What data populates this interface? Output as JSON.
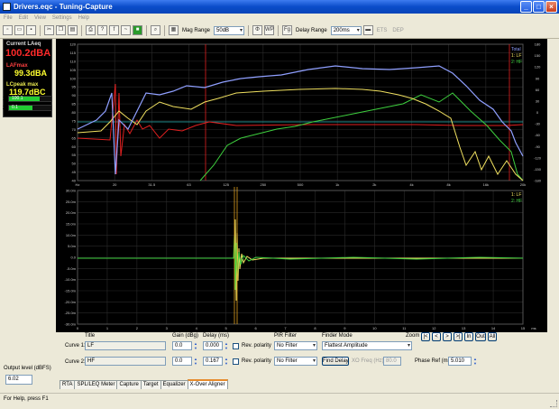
{
  "window": {
    "title": "Drivers.eqc - Tuning-Capture",
    "min": "_",
    "max": "□",
    "close": "×"
  },
  "menu": [
    "File",
    "Edit",
    "View",
    "Settings",
    "Help"
  ],
  "toolbar": {
    "mag_range_label": "Mag Range",
    "mag_range_value": "50dB",
    "delay_range_label": "Delay Range",
    "delay_range_value": "200ms",
    "wp": "WP",
    "fg": "Fg",
    "ets": "ETS",
    "dep": "DEP"
  },
  "meter": {
    "current_label": "Current LAeq",
    "current_value": "100.2dBA",
    "lafmax_label": "LAFmax",
    "lafmax_value": "99.3dBA",
    "lcpeak_label": "LCpeak max",
    "lcpeak_value": "119.7dBC",
    "channels": [
      {
        "n": "1:",
        "v": "100.1",
        "level": 0.72
      },
      {
        "n": "2:",
        "v": "0.1",
        "level": 0.55
      }
    ]
  },
  "output_level": {
    "label": "Output level (dBFS)",
    "value": "6.02"
  },
  "mag_chart": {
    "legend": [
      "Total",
      "1: LF",
      "2: HF"
    ],
    "left_ticks": [
      "120",
      "115",
      "110",
      "105",
      "100",
      "95",
      "90",
      "85",
      "80",
      "75",
      "70",
      "65",
      "60",
      "55",
      "50",
      "45",
      "40"
    ],
    "right_ticks": [
      "180",
      "150",
      "120",
      "90",
      "60",
      "30",
      "0",
      "-30",
      "-60",
      "-90",
      "-120",
      "-150",
      "-180"
    ],
    "x_ticks": [
      "Hz",
      "20",
      "31.5",
      "63",
      "125",
      "250",
      "500",
      "1k",
      "2k",
      "4k",
      "8k",
      "16k",
      "20k"
    ],
    "colors": {
      "total": "#7f8fff",
      "lf": "#f0e060",
      "hf": "#3ecf3e",
      "phase": "#e02020",
      "sweep": "#e02020",
      "teal": "#22aaaa"
    }
  },
  "ir_chart": {
    "legend": [
      "1: LF",
      "2: HF"
    ],
    "left_ticks": [
      "30.0m",
      "25.0m",
      "20.0m",
      "15.0m",
      "10.0m",
      "5.0m",
      "0.0",
      "-5.0m",
      "-10.0m",
      "-15.0m",
      "-20.0m",
      "-25.0m",
      "-30.0m"
    ],
    "x_ticks": [
      "0",
      "1",
      "2",
      "3",
      "4",
      "5",
      "6",
      "7",
      "8",
      "9",
      "10",
      "11",
      "12",
      "13",
      "14",
      "15"
    ],
    "x_unit": "ms"
  },
  "aligner": {
    "title_hdr": "Title",
    "gain_hdr": "Gain (dBg)",
    "delay_hdr": "Delay (ms)",
    "pir_hdr": "PIR Filter",
    "finder_hdr": "Finder Mode",
    "zoom_hdr": "Zoom",
    "curves": [
      {
        "label": "Curve 1:",
        "title": "LF",
        "gain": "0.0",
        "delay": "0.000",
        "rev": "Rev. polarity",
        "filter": "No Filter"
      },
      {
        "label": "Curve 2:",
        "title": "HF",
        "gain": "0.0",
        "delay": "0.167",
        "rev": "Rev. polarity",
        "filter": "No Filter"
      }
    ],
    "finder_mode": "Flattest Amplitude",
    "find_delay": "Find Delay",
    "xo_freq_label": "XO Freq (Hz)",
    "xo_freq": "80.0",
    "phase_ref_label": "Phase Ref (ms)",
    "phase_ref": "5.010",
    "zoom_btns": [
      "|<",
      "<",
      ">",
      ">|",
      "In",
      "Out",
      "All"
    ]
  },
  "tabs": [
    "RTA",
    "SPL/LEQ Meter",
    "Capture",
    "Target",
    "Equalizer",
    "X-Over Aligner"
  ],
  "status": "For Help, press F1"
}
